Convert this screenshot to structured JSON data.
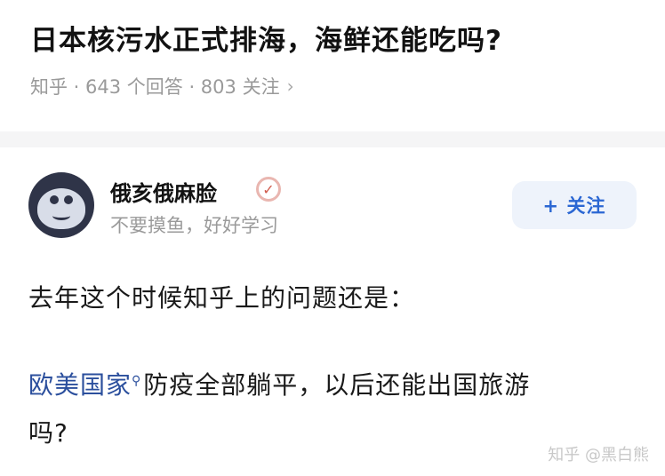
{
  "question": {
    "title": "日本核污水正式排海，海鲜还能吃吗?",
    "meta": "知乎 · 643 个回答 · 803 关注",
    "chevron": "›"
  },
  "author": {
    "name": "俄亥俄麻脸",
    "bio": "不要摸鱼，好好学习",
    "badge_icon": "verified-badge-icon",
    "badge_glyph": "✓"
  },
  "follow_button": {
    "label": "+ 关注"
  },
  "answer": {
    "line1": "去年这个时候知乎上的问题还是：",
    "line2_link": "欧美国家",
    "line2_rest": "防疫全部躺平，以后还能出国旅游",
    "line3": "吗?"
  },
  "watermark": "知乎 @黑白熊",
  "colors": {
    "link": "#2b4f9d",
    "follow_text": "#2b67d3",
    "follow_bg": "#eef3fb"
  }
}
